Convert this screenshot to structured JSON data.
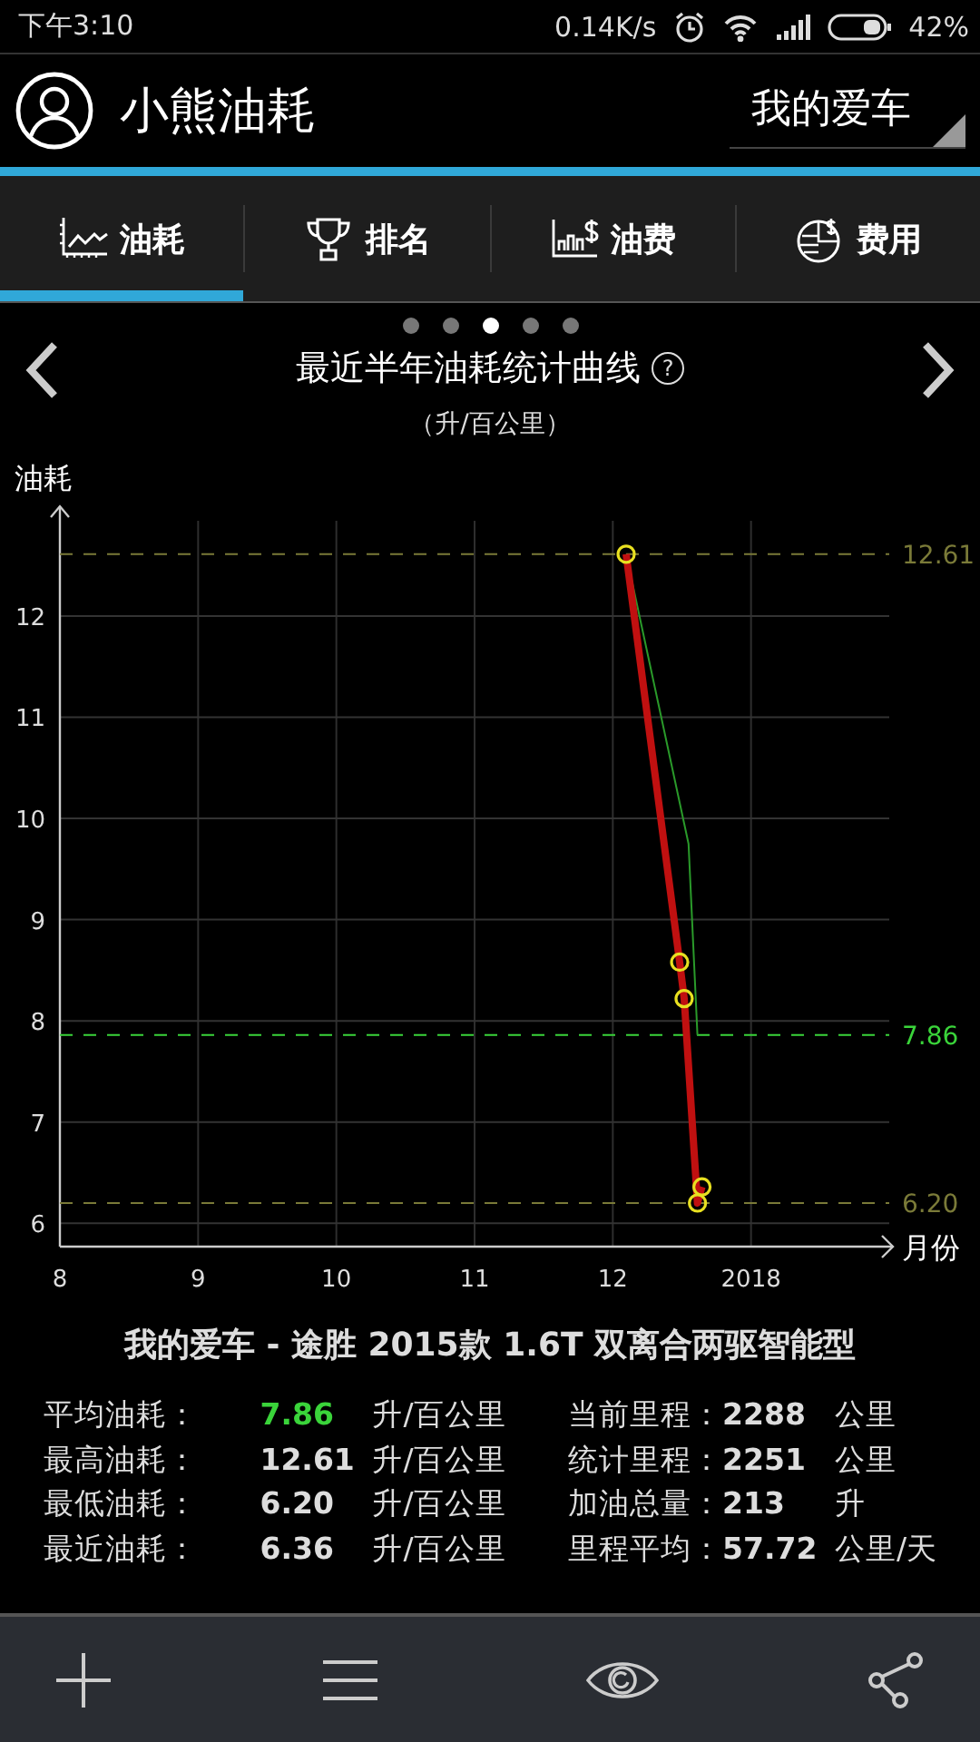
{
  "status_bar": {
    "time": "下午3:10",
    "speed": "0.14K/s",
    "battery": "42%"
  },
  "header": {
    "title": "小熊油耗",
    "car_selector": "我的爱车"
  },
  "tabs": [
    {
      "label": "油耗",
      "selected": true
    },
    {
      "label": "排名",
      "selected": false
    },
    {
      "label": "油费",
      "selected": false
    },
    {
      "label": "费用",
      "selected": false
    }
  ],
  "page_dots": [
    {
      "selected": false
    },
    {
      "selected": false
    },
    {
      "selected": true
    },
    {
      "selected": false
    },
    {
      "selected": false
    }
  ],
  "chart_panel": {
    "title": "最近半年油耗统计曲线",
    "help": "?",
    "subtitle": "（升/百公里）",
    "chart_data": {
      "type": "line",
      "xlabel": "月份",
      "ylabel": "油耗",
      "grid": true,
      "xlim": [
        "2017-08-01",
        "2018-02-01"
      ],
      "ylim": [
        5.77,
        12.94
      ],
      "xticks": [
        {
          "value": "2017-08-01",
          "label": "8"
        },
        {
          "value": "2017-09-01",
          "label": "9"
        },
        {
          "value": "2017-10-01",
          "label": "10"
        },
        {
          "value": "2017-11-01",
          "label": "11"
        },
        {
          "value": "2017-12-01",
          "label": "12"
        },
        {
          "value": "2018-01-01",
          "label": "2018"
        }
      ],
      "yticks": [
        6,
        7,
        8,
        9,
        10,
        11,
        12
      ],
      "series": [
        {
          "color": "#c01010",
          "marker": "circle",
          "x": [
            "2017-12-04",
            "2017-12-16",
            "2017-12-17",
            "2017-12-20",
            "2017-12-21"
          ],
          "values": [
            12.61,
            8.58,
            8.22,
            6.2,
            6.36
          ]
        },
        {
          "color": "#2a9a2a",
          "x": [
            "2017-12-04",
            "2017-12-18",
            "2017-12-20"
          ],
          "values": [
            12.61,
            9.75,
            7.86
          ]
        }
      ],
      "ref_lines": [
        {
          "axis": "y",
          "value": 12.61,
          "label": "12.61",
          "color": "#7a7a38"
        },
        {
          "axis": "y",
          "value": 7.86,
          "label": "7.86",
          "color": "#3ad43a"
        },
        {
          "axis": "y",
          "value": 6.2,
          "label": "6.20",
          "color": "#7a7a38"
        }
      ]
    }
  },
  "car_title": "我的爱车 - 途胜 2015款 1.6T 双离合两驱智能型",
  "stats": [
    [
      {
        "label": "平均油耗：",
        "value": "7.86",
        "unit": "升/百公里",
        "highlighted": true
      },
      {
        "label": "最高油耗：",
        "value": "12.61",
        "unit": "升/百公里",
        "highlighted": false
      },
      {
        "label": "最低油耗：",
        "value": "6.20",
        "unit": "升/百公里",
        "highlighted": false
      },
      {
        "label": "最近油耗：",
        "value": "6.36",
        "unit": "升/百公里",
        "highlighted": false
      }
    ],
    [
      {
        "label": "当前里程：",
        "value": "2288",
        "unit": "公里",
        "highlighted": false
      },
      {
        "label": "统计里程：",
        "value": "2251",
        "unit": "公里",
        "highlighted": false
      },
      {
        "label": "加油总量：",
        "value": "213",
        "unit": "升",
        "highlighted": false
      },
      {
        "label": "里程平均：",
        "value": "57.72",
        "unit": "公里/天",
        "highlighted": false
      }
    ]
  ]
}
